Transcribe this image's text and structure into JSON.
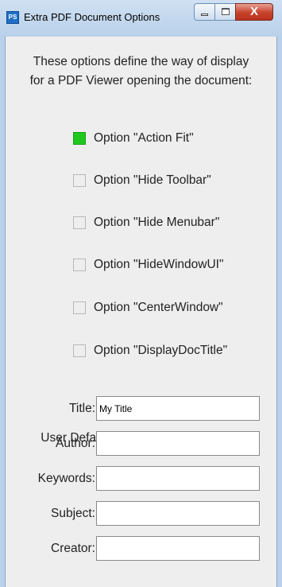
{
  "window": {
    "title": "Extra PDF Document Options",
    "icon": "ps-app-icon",
    "controls": {
      "minimize": "minimize-icon",
      "maximize": "maximize-icon",
      "close": "X"
    }
  },
  "intro": {
    "line1": "These options define the way of display",
    "line2": "for a PDF Viewer opening the document:"
  },
  "options": [
    {
      "label": "Option \"Action Fit\"",
      "checked": true
    },
    {
      "label": "Option \"Hide Toolbar\"",
      "checked": false
    },
    {
      "label": "Option \"Hide Menubar\"",
      "checked": false
    },
    {
      "label": "Option \"HideWindowUI\"",
      "checked": false
    },
    {
      "label": "Option \"CenterWindow\"",
      "checked": false
    },
    {
      "label": "Option \"DisplayDocTitle\"",
      "checked": false
    }
  ],
  "defaults": {
    "heading": "User Defaults for the PDF Info fields:",
    "fields": [
      {
        "label": "Title:",
        "value": "My Title"
      },
      {
        "label": "Author:",
        "value": ""
      },
      {
        "label": "Keywords:",
        "value": ""
      },
      {
        "label": "Subject:",
        "value": ""
      },
      {
        "label": "Creator:",
        "value": ""
      }
    ]
  },
  "colors": {
    "checked": "#1ec81e",
    "titlebar": "#b9d1ea",
    "panel": "#eeeeee",
    "close_button": "#c7412b"
  }
}
